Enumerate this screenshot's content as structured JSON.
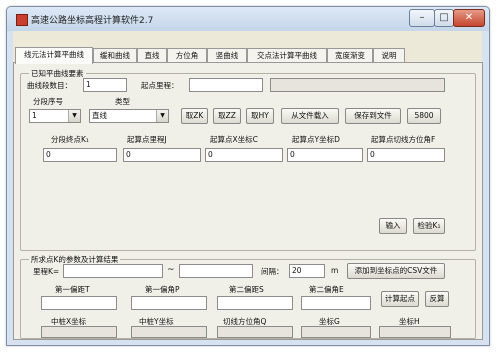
{
  "window": {
    "title": "高速公路坐标高程计算软件2.7",
    "minimize_glyph": "–",
    "maximize_glyph": "□",
    "close_glyph": "✕",
    "app_icon": "app-icon",
    "close_color": "#c4452c"
  },
  "tabs": [
    {
      "label": "线元法计算平曲线",
      "active": true
    },
    {
      "label": "缓和曲线"
    },
    {
      "label": "直线"
    },
    {
      "label": "方位角"
    },
    {
      "label": "竖曲线"
    },
    {
      "label": "交点法计算平曲线"
    },
    {
      "label": "宽度渐变"
    },
    {
      "label": "说明"
    }
  ],
  "known_elements": {
    "group_label": "已知平曲线要素",
    "segment_count_label": "曲线段数目：",
    "segment_count_value": "1",
    "start_station_label": "起点里程：",
    "start_station_value": "",
    "info_value": "",
    "segment_no_label": "分段序号",
    "segment_no_value": "1",
    "type_label": "类型",
    "type_value": "直线",
    "dropdown_glyph": "▼",
    "buttons": {
      "fetch_zk": "取ZK",
      "fetch_zz": "取ZZ",
      "fetch_hy": "取HY",
      "import_file": "从文件载入",
      "save_file": "保存到文件",
      "s800": "5800"
    },
    "params": [
      {
        "label": "分段终点K₁",
        "value": "0"
      },
      {
        "label": "起算点里程J",
        "value": "0"
      },
      {
        "label": "起算点X坐标C",
        "value": "0"
      },
      {
        "label": "起算点Y坐标D",
        "value": "0"
      },
      {
        "label": "起算点切线方位角F",
        "value": "0"
      }
    ],
    "input_button": "输入",
    "check_button": "检验K₁"
  },
  "calc": {
    "group_label": "所求点K的参数及计算结果",
    "station_label": "里程K=",
    "station_from": "",
    "tilde": "~",
    "station_to": "",
    "interval_label": "间隔：",
    "interval_value": "20",
    "interval_unit": "m",
    "add_csv_button": "添加到坐标点的CSV文件",
    "inputs": [
      {
        "label": "第一偏距T",
        "value": ""
      },
      {
        "label": "第一偏角P",
        "value": ""
      },
      {
        "label": "第二偏距S",
        "value": ""
      },
      {
        "label": "第二偏角E",
        "value": ""
      }
    ],
    "compute_start_button": "计算起点",
    "inverse_button": "反算",
    "results": [
      {
        "label": "中桩X坐标",
        "value": ""
      },
      {
        "label": "中桩Y坐标",
        "value": ""
      },
      {
        "label": "切线方位角Q",
        "value": ""
      },
      {
        "label": "坐标G",
        "value": ""
      },
      {
        "label": "坐标H",
        "value": ""
      }
    ]
  }
}
